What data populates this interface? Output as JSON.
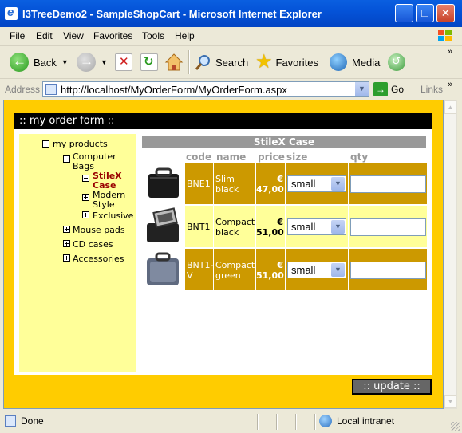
{
  "window": {
    "title": "I3TreeDemo2 - SampleShopCart - Microsoft Internet Explorer",
    "controls": {
      "minimize": "_",
      "maximize": "□",
      "close": "✕"
    }
  },
  "menu": [
    "File",
    "Edit",
    "View",
    "Favorites",
    "Tools",
    "Help"
  ],
  "toolbar": {
    "back": "Back",
    "search": "Search",
    "favorites": "Favorites",
    "media": "Media"
  },
  "address": {
    "label": "Address",
    "url": "http://localhost/MyOrderForm/MyOrderForm.aspx",
    "go": "Go",
    "links": "Links"
  },
  "page": {
    "header": ":: my order form ::",
    "update_button": ":: update ::",
    "tree": {
      "root": "my products",
      "computer_bags": "Computer Bags",
      "stilex_case": "StileX Case",
      "modern_style": "Modern Style",
      "exclusive": "Exclusive",
      "mouse_pads": "Mouse pads",
      "cd_cases": "CD cases",
      "accessories": "Accessories"
    },
    "table": {
      "caption": "StileX Case",
      "columns": {
        "code": "code",
        "name": "name",
        "price": "price",
        "size": "size",
        "qty": "qty"
      },
      "rows": [
        {
          "code": "BNE1",
          "name": "Slim black",
          "price_currency": "€",
          "price": "47,00",
          "size": "small",
          "qty": ""
        },
        {
          "code": "BNT1",
          "name": "Compact black",
          "price_currency": "€",
          "price": "51,00",
          "size": "small",
          "qty": ""
        },
        {
          "code": "BNT1-V",
          "name": "Compact green",
          "price_currency": "€",
          "price": "51,00",
          "size": "small",
          "qty": ""
        }
      ]
    },
    "colors": {
      "background": "#ffcc00",
      "tree_bg": "#ffff99",
      "row_dark": "#cc9900",
      "caption_bg": "#999999",
      "selected": "#990000"
    }
  },
  "status": {
    "text": "Done",
    "zone": "Local intranet"
  }
}
